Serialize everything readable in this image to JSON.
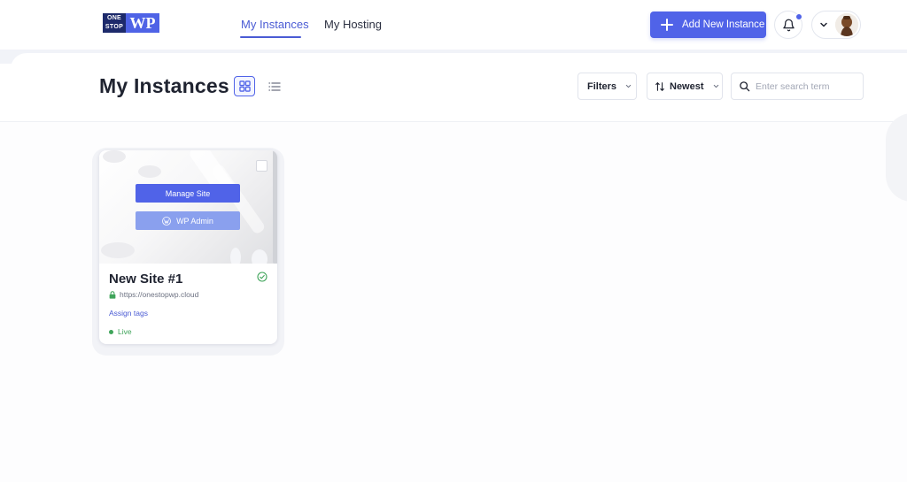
{
  "logo": {
    "line1": "ONE",
    "line2": "STOP",
    "mark": "WP"
  },
  "nav": {
    "tabs": [
      {
        "label": "My Instances",
        "active": true
      },
      {
        "label": "My Hosting",
        "active": false
      }
    ],
    "add_button_label": "Add New Instance",
    "notification_badge": true,
    "icons": {
      "add": "plus-icon",
      "notifications": "bell-icon",
      "account_menu": "chevron-down-icon"
    }
  },
  "toolbar": {
    "title": "My Instances",
    "view_modes": [
      {
        "name": "grid",
        "icon": "grid-icon",
        "active": true
      },
      {
        "name": "list",
        "icon": "list-icon",
        "active": false
      }
    ],
    "filters_label": "Filters",
    "sort_label": "Newest",
    "search": {
      "placeholder": "Enter search term",
      "value": ""
    }
  },
  "instances": [
    {
      "name": "New Site #1",
      "url": "https://onestopwp.cloud",
      "manage_label": "Manage Site",
      "wp_admin_label": "WP Admin",
      "tags_label": "Assign tags",
      "status": "Live",
      "selected": false
    }
  ],
  "colors": {
    "accent": "#5063e8",
    "accent_light": "#8aa0ee",
    "live": "#3fa45a",
    "text": "#1f2330"
  }
}
